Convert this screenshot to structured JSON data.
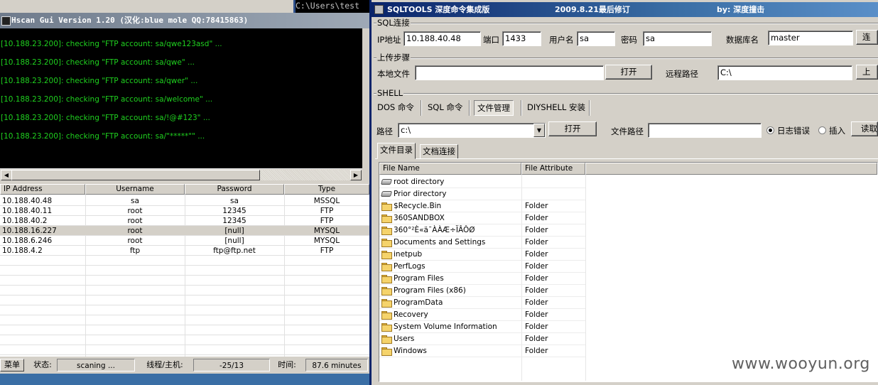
{
  "cmd": {
    "title": "C:\\Users\\test"
  },
  "hscan": {
    "title": "Hscan Gui Version 1.20 (汉化:blue mole QQ:78415863)",
    "log_lines": [
      "[10.188.23.200]: checking \"FTP account: sa/qwe123asd\" ...",
      "[10.188.23.200]: checking \"FTP account: sa/qwe\" ...",
      "[10.188.23.200]: checking \"FTP account: sa/qwer\" ...",
      "[10.188.23.200]: checking \"FTP account: sa/welcome\" ...",
      "[10.188.23.200]: checking \"FTP account: sa/!@#123\" ...",
      "[10.188.23.200]: checking \"FTP account: sa/\"*****\"\" ..."
    ],
    "columns": [
      "IP Address",
      "Username",
      "Password",
      "Type"
    ],
    "rows": [
      [
        "10.188.40.48",
        "sa",
        "sa",
        "MSSQL"
      ],
      [
        "10.188.40.11",
        "root",
        "12345",
        "FTP"
      ],
      [
        "10.188.40.2",
        "root",
        "12345",
        "FTP"
      ],
      [
        "10.188.16.227",
        "root",
        "[null]",
        "MYSQL"
      ],
      [
        "10.188.6.246",
        "root",
        "[null]",
        "MYSQL"
      ],
      [
        "10.188.4.2",
        "ftp",
        "ftp@ftp.net",
        "FTP"
      ]
    ],
    "status": {
      "menu_label": "菜单",
      "state_label": "状态:",
      "state_value": "scaning ...",
      "thread_label": "线程/主机:",
      "thread_value": "-25/13",
      "time_label": "时间:",
      "time_value": "87.6 minutes"
    }
  },
  "sqltools": {
    "title": "SQLTOOLS 深度命令集成版",
    "date": "2009.8.21最后修订",
    "author": "by: 深度撞击",
    "sql_group": "SQL连接",
    "ip_label": "IP地址",
    "ip_value": "10.188.40.48",
    "port_label": "端口",
    "port_value": "1433",
    "user_label": "用户名",
    "user_value": "sa",
    "pass_label": "密码",
    "pass_value": "sa",
    "db_label": "数据库名",
    "db_value": "master",
    "connect_button": "连",
    "upload_group": "上传步骤",
    "local_file_label": "本地文件",
    "local_file_value": "",
    "open_button": "打开",
    "remote_path_label": "远程路径",
    "remote_path_value": "C:\\",
    "upload_button": "上",
    "shell_group": "SHELL",
    "tabs": [
      "DOS 命令",
      "SQL 命令",
      "文件管理",
      "DIYSHELL 安装"
    ],
    "path_label": "路径",
    "path_value": "c:\\",
    "path_open_button": "打开",
    "file_path_label": "文件路径",
    "file_path_value": "",
    "radio_log": "日志错误",
    "radio_insert": "插入",
    "read_button": "读取",
    "panel_tabs": [
      "文件目录",
      "文档连接"
    ],
    "file_columns": [
      "File Name",
      "File Attribute"
    ],
    "files": [
      {
        "name": "root directory",
        "attr": "",
        "icon": "drive-icon"
      },
      {
        "name": "Prior directory",
        "attr": "",
        "icon": "drive-icon"
      },
      {
        "name": "$Recycle.Bin",
        "attr": "Folder",
        "icon": "folder-icon"
      },
      {
        "name": "360SANDBOX",
        "attr": "Folder",
        "icon": "folder-icon"
      },
      {
        "name": "360°²È«ä¯ÀÀÆ÷ÏÂÔØ",
        "attr": "Folder",
        "icon": "folder-icon"
      },
      {
        "name": "Documents and Settings",
        "attr": "Folder",
        "icon": "folder-icon"
      },
      {
        "name": "inetpub",
        "attr": "Folder",
        "icon": "folder-icon"
      },
      {
        "name": "PerfLogs",
        "attr": "Folder",
        "icon": "folder-icon"
      },
      {
        "name": "Program Files",
        "attr": "Folder",
        "icon": "folder-icon"
      },
      {
        "name": "Program Files (x86)",
        "attr": "Folder",
        "icon": "folder-icon"
      },
      {
        "name": "ProgramData",
        "attr": "Folder",
        "icon": "folder-icon"
      },
      {
        "name": "Recovery",
        "attr": "Folder",
        "icon": "folder-icon"
      },
      {
        "name": "System Volume Information",
        "attr": "Folder",
        "icon": "folder-icon"
      },
      {
        "name": "Users",
        "attr": "Folder",
        "icon": "folder-icon"
      },
      {
        "name": "Windows",
        "attr": "Folder",
        "icon": "folder-icon"
      }
    ]
  },
  "watermark": "www.wooyun.org"
}
